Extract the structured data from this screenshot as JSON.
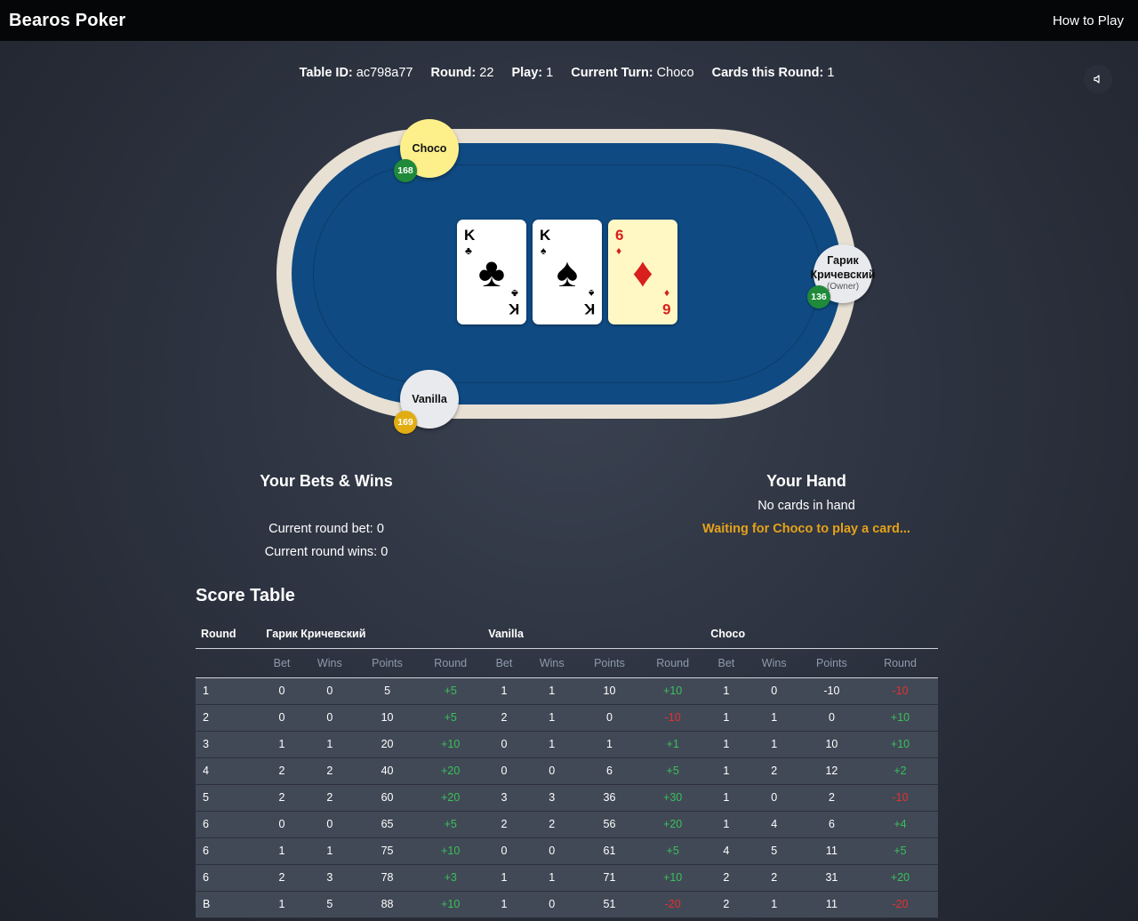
{
  "app": {
    "brand": "Bearos Poker",
    "how_to_play": "How to Play"
  },
  "info": {
    "table_id_label": "Table ID:",
    "table_id": "ac798a77",
    "round_label": "Round:",
    "round": "22",
    "play_label": "Play:",
    "play": "1",
    "turn_label": "Current Turn:",
    "turn": "Choco",
    "cards_label": "Cards this Round:",
    "cards": "1"
  },
  "table": {
    "cards": [
      {
        "rank": "K",
        "suit": "♣",
        "color": "black",
        "highlight": false
      },
      {
        "rank": "K",
        "suit": "♠",
        "color": "black",
        "highlight": false
      },
      {
        "rank": "6",
        "suit": "♦",
        "color": "red",
        "highlight": true
      }
    ],
    "players": {
      "choco": {
        "name": "Choco",
        "chips": "168",
        "chip_color": "#1f8a3a",
        "seat_color": "#fdf08a"
      },
      "vanilla": {
        "name": "Vanilla",
        "chips": "169",
        "chip_color": "#e2ad12",
        "seat_color": "#e9eaee"
      },
      "garik": {
        "name_line1": "Гарик",
        "name_line2": "Кричевский",
        "owner": "(Owner)",
        "chips": "136",
        "chip_color": "#1f8a3a",
        "seat_color": "#e9eaee"
      }
    },
    "felt_color": "#0f4a82",
    "rail_color": "#e7e0d3"
  },
  "bets_panel": {
    "title": "Your Bets & Wins",
    "round_bet": "Current round bet: 0",
    "round_wins": "Current round wins: 0"
  },
  "hand_panel": {
    "title": "Your Hand",
    "empty": "No cards in hand",
    "status": "Waiting for Choco to play a card..."
  },
  "score": {
    "title": "Score Table",
    "round_header": "Round",
    "players": [
      "Гарик Кричевский",
      "Vanilla",
      "Choco"
    ],
    "subheaders": [
      "Bet",
      "Wins",
      "Points",
      "Round"
    ],
    "rows": [
      {
        "round": "1",
        "cells": [
          [
            "0",
            "0",
            "5",
            "+5"
          ],
          [
            "1",
            "1",
            "10",
            "+10"
          ],
          [
            "1",
            "0",
            "-10",
            "-10"
          ]
        ]
      },
      {
        "round": "2",
        "cells": [
          [
            "0",
            "0",
            "10",
            "+5"
          ],
          [
            "2",
            "1",
            "0",
            "-10"
          ],
          [
            "1",
            "1",
            "0",
            "+10"
          ]
        ]
      },
      {
        "round": "3",
        "cells": [
          [
            "1",
            "1",
            "20",
            "+10"
          ],
          [
            "0",
            "1",
            "1",
            "+1"
          ],
          [
            "1",
            "1",
            "10",
            "+10"
          ]
        ]
      },
      {
        "round": "4",
        "cells": [
          [
            "2",
            "2",
            "40",
            "+20"
          ],
          [
            "0",
            "0",
            "6",
            "+5"
          ],
          [
            "1",
            "2",
            "12",
            "+2"
          ]
        ]
      },
      {
        "round": "5",
        "cells": [
          [
            "2",
            "2",
            "60",
            "+20"
          ],
          [
            "3",
            "3",
            "36",
            "+30"
          ],
          [
            "1",
            "0",
            "2",
            "-10"
          ]
        ]
      },
      {
        "round": "6",
        "cells": [
          [
            "0",
            "0",
            "65",
            "+5"
          ],
          [
            "2",
            "2",
            "56",
            "+20"
          ],
          [
            "1",
            "4",
            "6",
            "+4"
          ]
        ]
      },
      {
        "round": "6",
        "cells": [
          [
            "1",
            "1",
            "75",
            "+10"
          ],
          [
            "0",
            "0",
            "61",
            "+5"
          ],
          [
            "4",
            "5",
            "11",
            "+5"
          ]
        ]
      },
      {
        "round": "6",
        "cells": [
          [
            "2",
            "3",
            "78",
            "+3"
          ],
          [
            "1",
            "1",
            "71",
            "+10"
          ],
          [
            "2",
            "2",
            "31",
            "+20"
          ]
        ]
      },
      {
        "round": "B",
        "cells": [
          [
            "1",
            "5",
            "88",
            "+10"
          ],
          [
            "1",
            "0",
            "51",
            "-20"
          ],
          [
            "2",
            "1",
            "11",
            "-20"
          ]
        ]
      }
    ]
  }
}
